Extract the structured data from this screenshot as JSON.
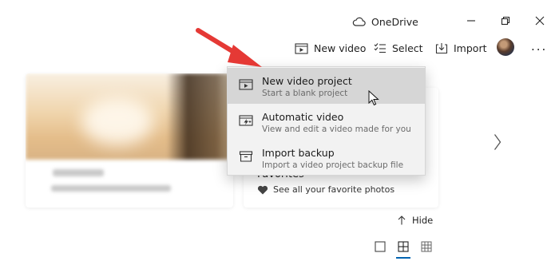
{
  "title_bar": {
    "onedrive_label": "OneDrive"
  },
  "toolbar": {
    "new_video_label": "New video",
    "select_label": "Select",
    "import_label": "Import",
    "more_label": "..."
  },
  "menu": {
    "items": [
      {
        "label": "New video project",
        "description": "Start a blank project",
        "icon": "new-video-project-icon"
      },
      {
        "label": "Automatic video",
        "description": "View and edit a video made for you",
        "icon": "automatic-video-icon"
      },
      {
        "label": "Import backup",
        "description": "Import a video project backup file",
        "icon": "import-backup-icon"
      }
    ]
  },
  "cards": {
    "favorites_title": "Favorites",
    "favorites_subtitle": "See all your favorite photos"
  },
  "hide_label": "Hide",
  "colors": {
    "accent": "#0063b1",
    "annotation_arrow": "#e53935",
    "menu_background": "#f2f2f2",
    "menu_hover": "#d6d6d6"
  }
}
